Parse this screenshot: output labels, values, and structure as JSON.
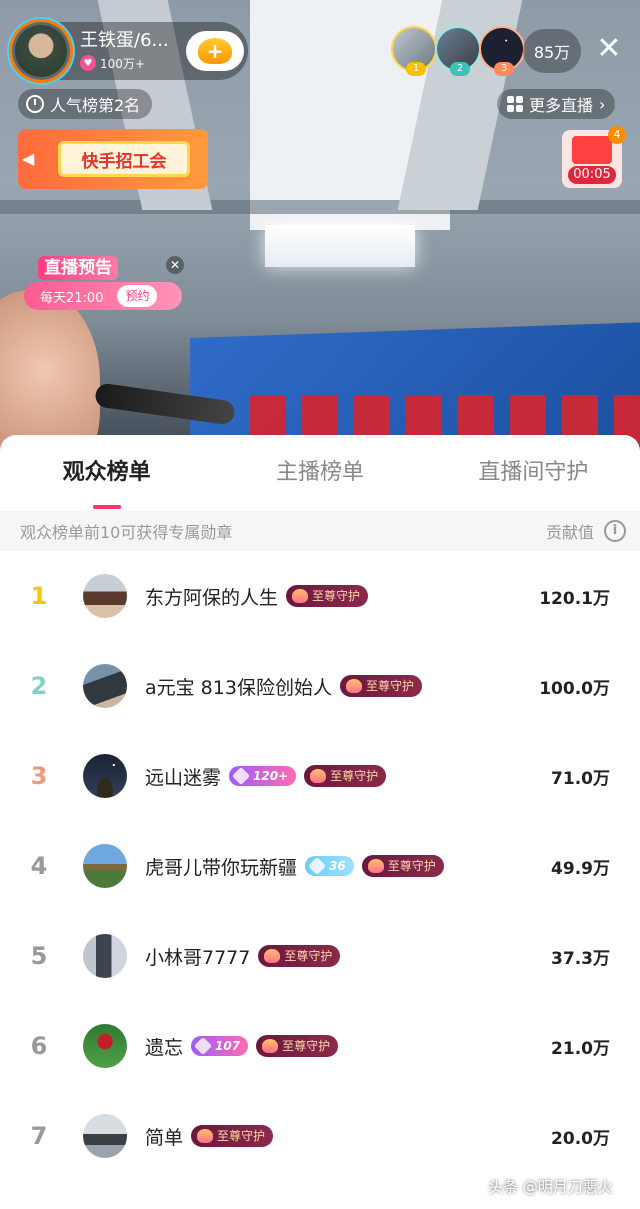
{
  "host": {
    "name": "王铁蛋/6...",
    "likes": "100万+",
    "follow_label": "+"
  },
  "top_viewers": [
    "1",
    "2",
    "3"
  ],
  "viewer_count": "85万",
  "close_label": "✕",
  "popularity_rank": "人气榜第2名",
  "more_live": "更多直播",
  "union_banner": "快手招工会",
  "red_packet": {
    "badge": "4",
    "timer": "00:05"
  },
  "preview": {
    "title": "直播预告",
    "time": "每天21:00",
    "reserve_label": "预约",
    "close_label": "✕"
  },
  "tabs": [
    {
      "label": "观众榜单",
      "active": true
    },
    {
      "label": "主播榜单",
      "active": false
    },
    {
      "label": "直播间守护",
      "active": false
    }
  ],
  "subheader": {
    "hint": "观众榜单前10可获得专属勋章",
    "contribution_label": "贡献值",
    "info_icon": "i"
  },
  "guard_badge_label": "至尊守护",
  "rankings": [
    {
      "rank": "1",
      "name": "东方阿保的人生",
      "level": "",
      "value": "120.1万"
    },
    {
      "rank": "2",
      "name": "a元宝 813保险创始人",
      "level": "",
      "value": "100.0万"
    },
    {
      "rank": "3",
      "name": "远山迷雾",
      "level": "120+",
      "value": "71.0万"
    },
    {
      "rank": "4",
      "name": "虎哥儿带你玩新疆",
      "level": "36",
      "value": "49.9万"
    },
    {
      "rank": "5",
      "name": "小林哥7777",
      "level": "",
      "value": "37.3万"
    },
    {
      "rank": "6",
      "name": "遗忘",
      "level": "107",
      "value": "21.0万"
    },
    {
      "rank": "7",
      "name": "简单",
      "level": "",
      "value": "20.0万"
    }
  ],
  "watermark": "头条 @明月刀悪火",
  "colors": {
    "accent": "#fe3666",
    "rank1": "#f6c800",
    "rank2": "#7ed2c8",
    "rank3": "#ec9b7f",
    "guard_badge": "#6a1840"
  }
}
